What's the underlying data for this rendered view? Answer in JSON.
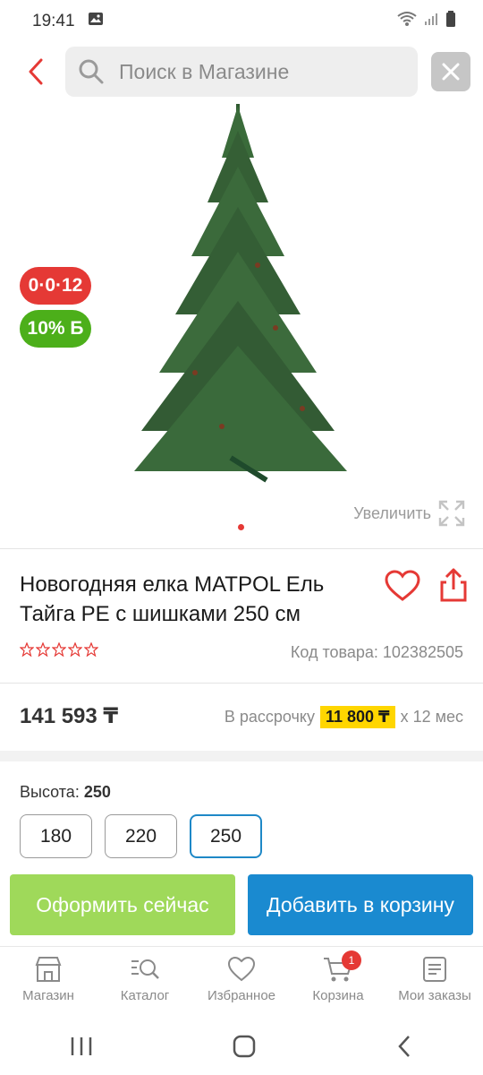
{
  "status": {
    "time": "19:41"
  },
  "search": {
    "placeholder": "Поиск в Магазине"
  },
  "hero": {
    "badge_installment": "0·0·12",
    "badge_bonus": "10% Б",
    "zoom_label": "Увеличить"
  },
  "product": {
    "title": "Новогодняя елка MATPOL Ель Тайга PE с шишками 250 см",
    "rating_stars": 0,
    "sku": "Код товара: 102382505",
    "price": "141 593 ₸",
    "installment_prefix": "В рассрочку",
    "installment_amount": "11 800 ₸",
    "installment_suffix": "x 12 мес"
  },
  "options": {
    "height_label": "Высота:",
    "height_value": "250",
    "sizes": [
      "180",
      "220",
      "250"
    ],
    "selected": "250"
  },
  "actions": {
    "buy_now": "Оформить сейчас",
    "add_to_cart": "Добавить в корзину"
  },
  "nav": {
    "shop": "Магазин",
    "catalog": "Каталог",
    "favorites": "Избранное",
    "cart": "Корзина",
    "cart_count": "1",
    "orders": "Мои заказы"
  },
  "colors": {
    "accent_red": "#e53935",
    "green": "#4caf1a",
    "buy_btn": "#9fd95a",
    "cart_btn": "#1a8ad0",
    "highlight": "#ffd600"
  }
}
